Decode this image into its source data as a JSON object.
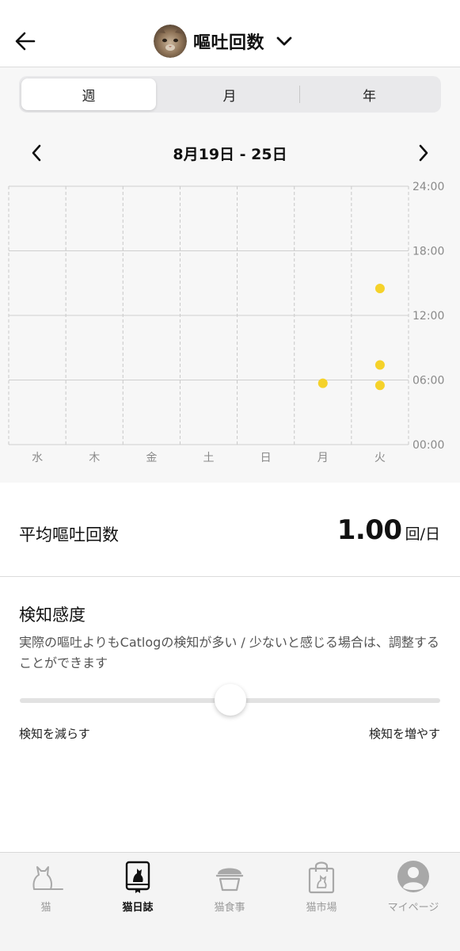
{
  "header": {
    "title": "嘔吐回数",
    "back_icon": "arrow-left-icon",
    "dropdown_icon": "chevron-down-icon",
    "avatar": "cat-avatar"
  },
  "period_tabs": [
    {
      "label": "週",
      "active": true
    },
    {
      "label": "月",
      "active": false
    },
    {
      "label": "年",
      "active": false
    }
  ],
  "date_nav": {
    "range": "8月19日 - 25日",
    "prev_icon": "chevron-left-icon",
    "next_icon": "chevron-right-icon"
  },
  "chart_data": {
    "type": "scatter",
    "x_categories": [
      "水",
      "木",
      "金",
      "土",
      "日",
      "月",
      "火"
    ],
    "y_ticks": [
      "00:00",
      "06:00",
      "12:00",
      "18:00",
      "24:00"
    ],
    "ylim": [
      0,
      24
    ],
    "point_color": "#f5d22a",
    "points": [
      {
        "day": "月",
        "hour": 5.7
      },
      {
        "day": "火",
        "hour": 5.5
      },
      {
        "day": "火",
        "hour": 7.4
      },
      {
        "day": "火",
        "hour": 14.5
      }
    ]
  },
  "average": {
    "label": "平均嘔吐回数",
    "value": "1.00",
    "unit": "回/日"
  },
  "sensitivity": {
    "title": "検知感度",
    "description": "実際の嘔吐よりもCatlogの検知が多い / 少ないと感じる場合は、調整することができます",
    "min_label": "検知を減らす",
    "max_label": "検知を増やす",
    "level": 0.5
  },
  "tabbar": [
    {
      "label": "猫",
      "icon": "cat-icon",
      "active": false
    },
    {
      "label": "猫日誌",
      "icon": "diary-icon",
      "active": true
    },
    {
      "label": "猫食事",
      "icon": "food-bowl-icon",
      "active": false
    },
    {
      "label": "猫市場",
      "icon": "shopping-bag-icon",
      "active": false
    },
    {
      "label": "マイページ",
      "icon": "user-icon",
      "active": false
    }
  ]
}
